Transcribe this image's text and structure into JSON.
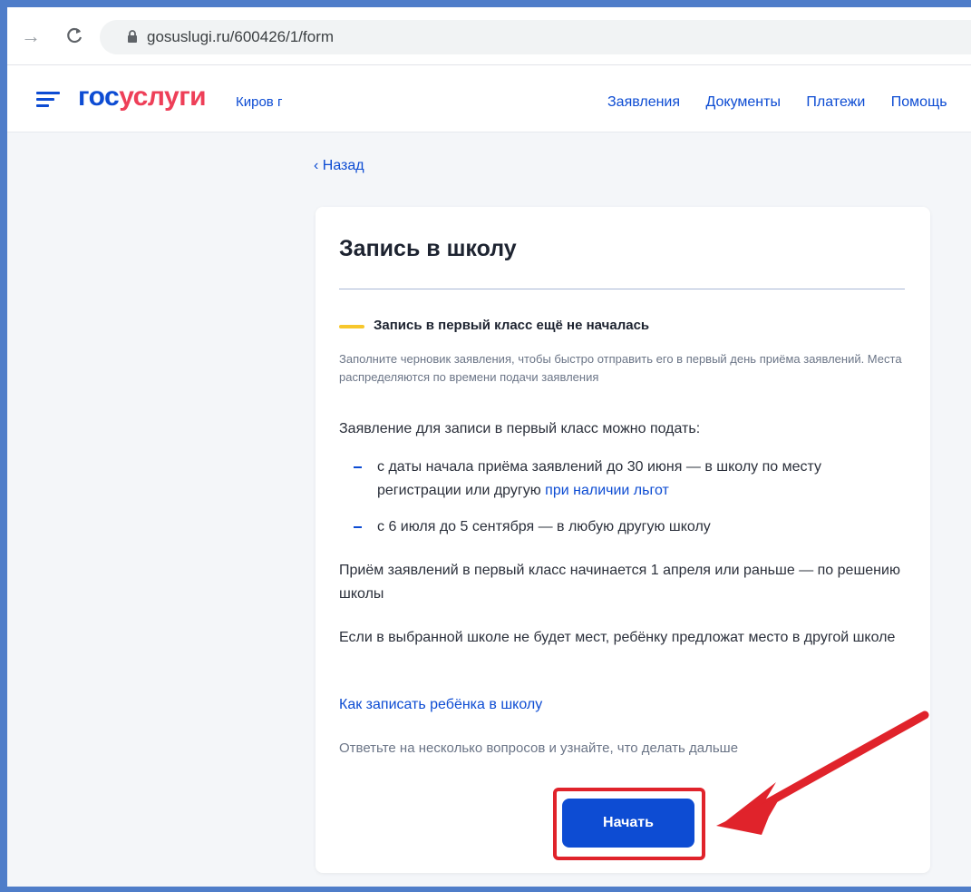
{
  "browser": {
    "url": "gosuslugi.ru/600426/1/form"
  },
  "header": {
    "logo_part1": "гос",
    "logo_part2": "услуги",
    "region": "Киров г",
    "nav": [
      "Заявления",
      "Документы",
      "Платежи",
      "Помощь"
    ]
  },
  "back_link": "‹ Назад",
  "card": {
    "title": "Запись в школу",
    "status_title": "Запись в первый класс ещё не началась",
    "status_desc": "Заполните черновик заявления, чтобы быстро отправить его в первый день приёма заявлений. Места распределяются по времени подачи заявления",
    "intro": "Заявление для записи в первый класс можно подать:",
    "list": [
      {
        "text": "с даты начала приёма заявлений до 30 июня — в школу по месту регистрации или другую ",
        "link": "при наличии льгот"
      },
      {
        "text": "с 6 июля до 5 сентября — в любую другую школу",
        "link": ""
      }
    ],
    "para1": "Приём заявлений в первый класс начинается 1 апреля или раньше — по решению школы",
    "para2": "Если в выбранной школе не будет мест, ребёнку предложат место в другой школе",
    "how_link": "Как записать ребёнка в школу",
    "hint": "Ответьте на несколько вопросов и узнайте, что делать дальше",
    "start_button": "Начать"
  },
  "colors": {
    "brand_blue": "#0d4cd3",
    "brand_red": "#ee3f58",
    "status_yellow": "#f7c72c",
    "annotation_red": "#e0232b"
  }
}
